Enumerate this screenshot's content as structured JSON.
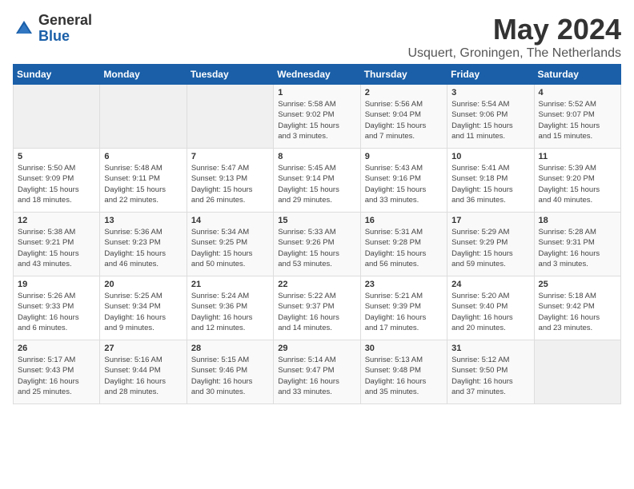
{
  "logo": {
    "general": "General",
    "blue": "Blue"
  },
  "title": "May 2024",
  "location": "Usquert, Groningen, The Netherlands",
  "weekdays": [
    "Sunday",
    "Monday",
    "Tuesday",
    "Wednesday",
    "Thursday",
    "Friday",
    "Saturday"
  ],
  "weeks": [
    [
      {
        "day": "",
        "info": ""
      },
      {
        "day": "",
        "info": ""
      },
      {
        "day": "",
        "info": ""
      },
      {
        "day": "1",
        "info": "Sunrise: 5:58 AM\nSunset: 9:02 PM\nDaylight: 15 hours\nand 3 minutes."
      },
      {
        "day": "2",
        "info": "Sunrise: 5:56 AM\nSunset: 9:04 PM\nDaylight: 15 hours\nand 7 minutes."
      },
      {
        "day": "3",
        "info": "Sunrise: 5:54 AM\nSunset: 9:06 PM\nDaylight: 15 hours\nand 11 minutes."
      },
      {
        "day": "4",
        "info": "Sunrise: 5:52 AM\nSunset: 9:07 PM\nDaylight: 15 hours\nand 15 minutes."
      }
    ],
    [
      {
        "day": "5",
        "info": "Sunrise: 5:50 AM\nSunset: 9:09 PM\nDaylight: 15 hours\nand 18 minutes."
      },
      {
        "day": "6",
        "info": "Sunrise: 5:48 AM\nSunset: 9:11 PM\nDaylight: 15 hours\nand 22 minutes."
      },
      {
        "day": "7",
        "info": "Sunrise: 5:47 AM\nSunset: 9:13 PM\nDaylight: 15 hours\nand 26 minutes."
      },
      {
        "day": "8",
        "info": "Sunrise: 5:45 AM\nSunset: 9:14 PM\nDaylight: 15 hours\nand 29 minutes."
      },
      {
        "day": "9",
        "info": "Sunrise: 5:43 AM\nSunset: 9:16 PM\nDaylight: 15 hours\nand 33 minutes."
      },
      {
        "day": "10",
        "info": "Sunrise: 5:41 AM\nSunset: 9:18 PM\nDaylight: 15 hours\nand 36 minutes."
      },
      {
        "day": "11",
        "info": "Sunrise: 5:39 AM\nSunset: 9:20 PM\nDaylight: 15 hours\nand 40 minutes."
      }
    ],
    [
      {
        "day": "12",
        "info": "Sunrise: 5:38 AM\nSunset: 9:21 PM\nDaylight: 15 hours\nand 43 minutes."
      },
      {
        "day": "13",
        "info": "Sunrise: 5:36 AM\nSunset: 9:23 PM\nDaylight: 15 hours\nand 46 minutes."
      },
      {
        "day": "14",
        "info": "Sunrise: 5:34 AM\nSunset: 9:25 PM\nDaylight: 15 hours\nand 50 minutes."
      },
      {
        "day": "15",
        "info": "Sunrise: 5:33 AM\nSunset: 9:26 PM\nDaylight: 15 hours\nand 53 minutes."
      },
      {
        "day": "16",
        "info": "Sunrise: 5:31 AM\nSunset: 9:28 PM\nDaylight: 15 hours\nand 56 minutes."
      },
      {
        "day": "17",
        "info": "Sunrise: 5:29 AM\nSunset: 9:29 PM\nDaylight: 15 hours\nand 59 minutes."
      },
      {
        "day": "18",
        "info": "Sunrise: 5:28 AM\nSunset: 9:31 PM\nDaylight: 16 hours\nand 3 minutes."
      }
    ],
    [
      {
        "day": "19",
        "info": "Sunrise: 5:26 AM\nSunset: 9:33 PM\nDaylight: 16 hours\nand 6 minutes."
      },
      {
        "day": "20",
        "info": "Sunrise: 5:25 AM\nSunset: 9:34 PM\nDaylight: 16 hours\nand 9 minutes."
      },
      {
        "day": "21",
        "info": "Sunrise: 5:24 AM\nSunset: 9:36 PM\nDaylight: 16 hours\nand 12 minutes."
      },
      {
        "day": "22",
        "info": "Sunrise: 5:22 AM\nSunset: 9:37 PM\nDaylight: 16 hours\nand 14 minutes."
      },
      {
        "day": "23",
        "info": "Sunrise: 5:21 AM\nSunset: 9:39 PM\nDaylight: 16 hours\nand 17 minutes."
      },
      {
        "day": "24",
        "info": "Sunrise: 5:20 AM\nSunset: 9:40 PM\nDaylight: 16 hours\nand 20 minutes."
      },
      {
        "day": "25",
        "info": "Sunrise: 5:18 AM\nSunset: 9:42 PM\nDaylight: 16 hours\nand 23 minutes."
      }
    ],
    [
      {
        "day": "26",
        "info": "Sunrise: 5:17 AM\nSunset: 9:43 PM\nDaylight: 16 hours\nand 25 minutes."
      },
      {
        "day": "27",
        "info": "Sunrise: 5:16 AM\nSunset: 9:44 PM\nDaylight: 16 hours\nand 28 minutes."
      },
      {
        "day": "28",
        "info": "Sunrise: 5:15 AM\nSunset: 9:46 PM\nDaylight: 16 hours\nand 30 minutes."
      },
      {
        "day": "29",
        "info": "Sunrise: 5:14 AM\nSunset: 9:47 PM\nDaylight: 16 hours\nand 33 minutes."
      },
      {
        "day": "30",
        "info": "Sunrise: 5:13 AM\nSunset: 9:48 PM\nDaylight: 16 hours\nand 35 minutes."
      },
      {
        "day": "31",
        "info": "Sunrise: 5:12 AM\nSunset: 9:50 PM\nDaylight: 16 hours\nand 37 minutes."
      },
      {
        "day": "",
        "info": ""
      }
    ]
  ]
}
